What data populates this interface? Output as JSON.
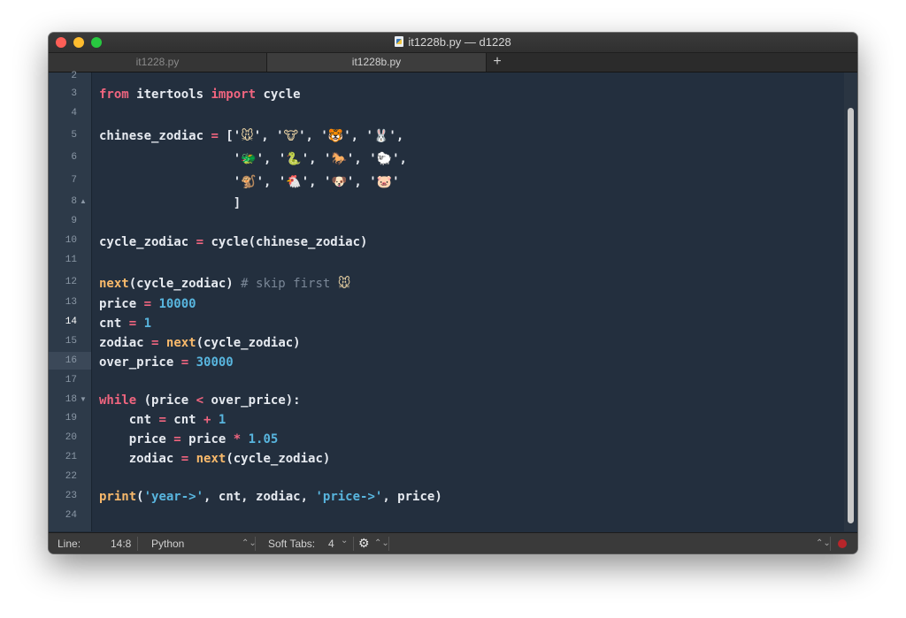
{
  "window": {
    "title": "it1228b.py — d1228",
    "tabs": [
      {
        "label": "it1228.py",
        "active": false
      },
      {
        "label": "it1228b.py",
        "active": true
      }
    ],
    "new_tab_label": "+"
  },
  "editor": {
    "current_line": "14",
    "lines": [
      {
        "num": "2"
      },
      {
        "num": "3"
      },
      {
        "num": "4"
      },
      {
        "num": "5"
      },
      {
        "num": "6"
      },
      {
        "num": "7"
      },
      {
        "num": "8",
        "fold": "▲"
      },
      {
        "num": "9"
      },
      {
        "num": "10"
      },
      {
        "num": "11"
      },
      {
        "num": "12"
      },
      {
        "num": "13"
      },
      {
        "num": "14"
      },
      {
        "num": "15"
      },
      {
        "num": "16"
      },
      {
        "num": "17"
      },
      {
        "num": "18",
        "fold": "▼"
      },
      {
        "num": "19"
      },
      {
        "num": "20"
      },
      {
        "num": "21"
      },
      {
        "num": "22"
      },
      {
        "num": "23"
      },
      {
        "num": "24"
      }
    ],
    "code": {
      "l3": [
        "from",
        " itertools ",
        "import",
        " cycle"
      ],
      "l5": [
        "chinese_zodiac ",
        "=",
        " ['",
        "🐭",
        "', '",
        "🐮",
        "', '",
        "🐯",
        "', '",
        "🐰",
        "',"
      ],
      "l6": [
        "                  '",
        "🐲",
        "', '",
        "🐍",
        "', '",
        "🐎",
        "', '",
        "🐑",
        "',"
      ],
      "l7": [
        "                  '",
        "🐒",
        "', '",
        "🐔",
        "', '",
        "🐶",
        "', '",
        "🐷",
        "'"
      ],
      "l8": [
        "                  ]"
      ],
      "l10": [
        "cycle_zodiac ",
        "=",
        " cycle(chinese_zodiac)"
      ],
      "l12": [
        "next",
        "(cycle_zodiac) ",
        "# skip first ",
        "🐭"
      ],
      "l13": [
        "price ",
        "=",
        " ",
        "10000"
      ],
      "l14": [
        "cnt ",
        "=",
        " ",
        "1"
      ],
      "l15": [
        "zodiac ",
        "=",
        " ",
        "next",
        "(cycle_zodiac)"
      ],
      "l16": [
        "over_price ",
        "=",
        " ",
        "30000"
      ],
      "l18": [
        "while",
        " (price ",
        "<",
        " over_price):"
      ],
      "l19": [
        "    cnt ",
        "=",
        " cnt ",
        "+",
        " ",
        "1"
      ],
      "l20": [
        "    price ",
        "=",
        " price ",
        "*",
        " ",
        "1.05"
      ],
      "l21": [
        "    zodiac ",
        "=",
        " ",
        "next",
        "(cycle_zodiac)"
      ],
      "l23": [
        "print",
        "(",
        "'year->'",
        ", cnt, zodiac, ",
        "'price->'",
        ", price)"
      ]
    }
  },
  "statusbar": {
    "line_label": "Line:",
    "position": "14:8",
    "language": "Python",
    "soft_tabs_label": "Soft Tabs:",
    "tab_size": "4",
    "chevron": "⌄",
    "updown": "⌃⌄",
    "gear_icon": "gear-icon"
  }
}
